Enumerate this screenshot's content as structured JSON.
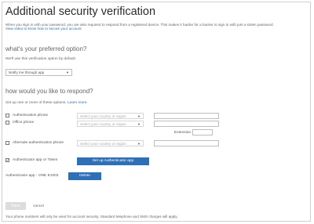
{
  "page": {
    "title": "Additional security verification",
    "intro_text": "When you sign in with your password, you are also required to respond from a registered device. This makes it harder for a hacker to sign in with just a stolen password.",
    "intro_link": "View video to know how to secure your account"
  },
  "preferred": {
    "heading": "what's your preferred option?",
    "description": "We'll use this verification option by default.",
    "selected_option": "Notify me through app"
  },
  "respond": {
    "heading": "how would you like to respond?",
    "description": "Set up one or more of these options.",
    "learn_more": "Learn more"
  },
  "options": {
    "auth_phone_label": "Authentication phone",
    "office_phone_label": "Office phone",
    "alt_phone_label": "Alternate authentication phone",
    "country_placeholder": "Select your country or region",
    "extension_label": "Extension",
    "app_label": "Authenticator app or Token",
    "setup_app_button": "Set up Authenticator app",
    "registered_device": "Authenticator app - ONE E1003",
    "delete_button": "Delete"
  },
  "footer": {
    "save_button": "Save",
    "cancel_link": "cancel",
    "note": "Your phone numbers will only be used for account security. Standard telephone and SMS charges will apply."
  }
}
